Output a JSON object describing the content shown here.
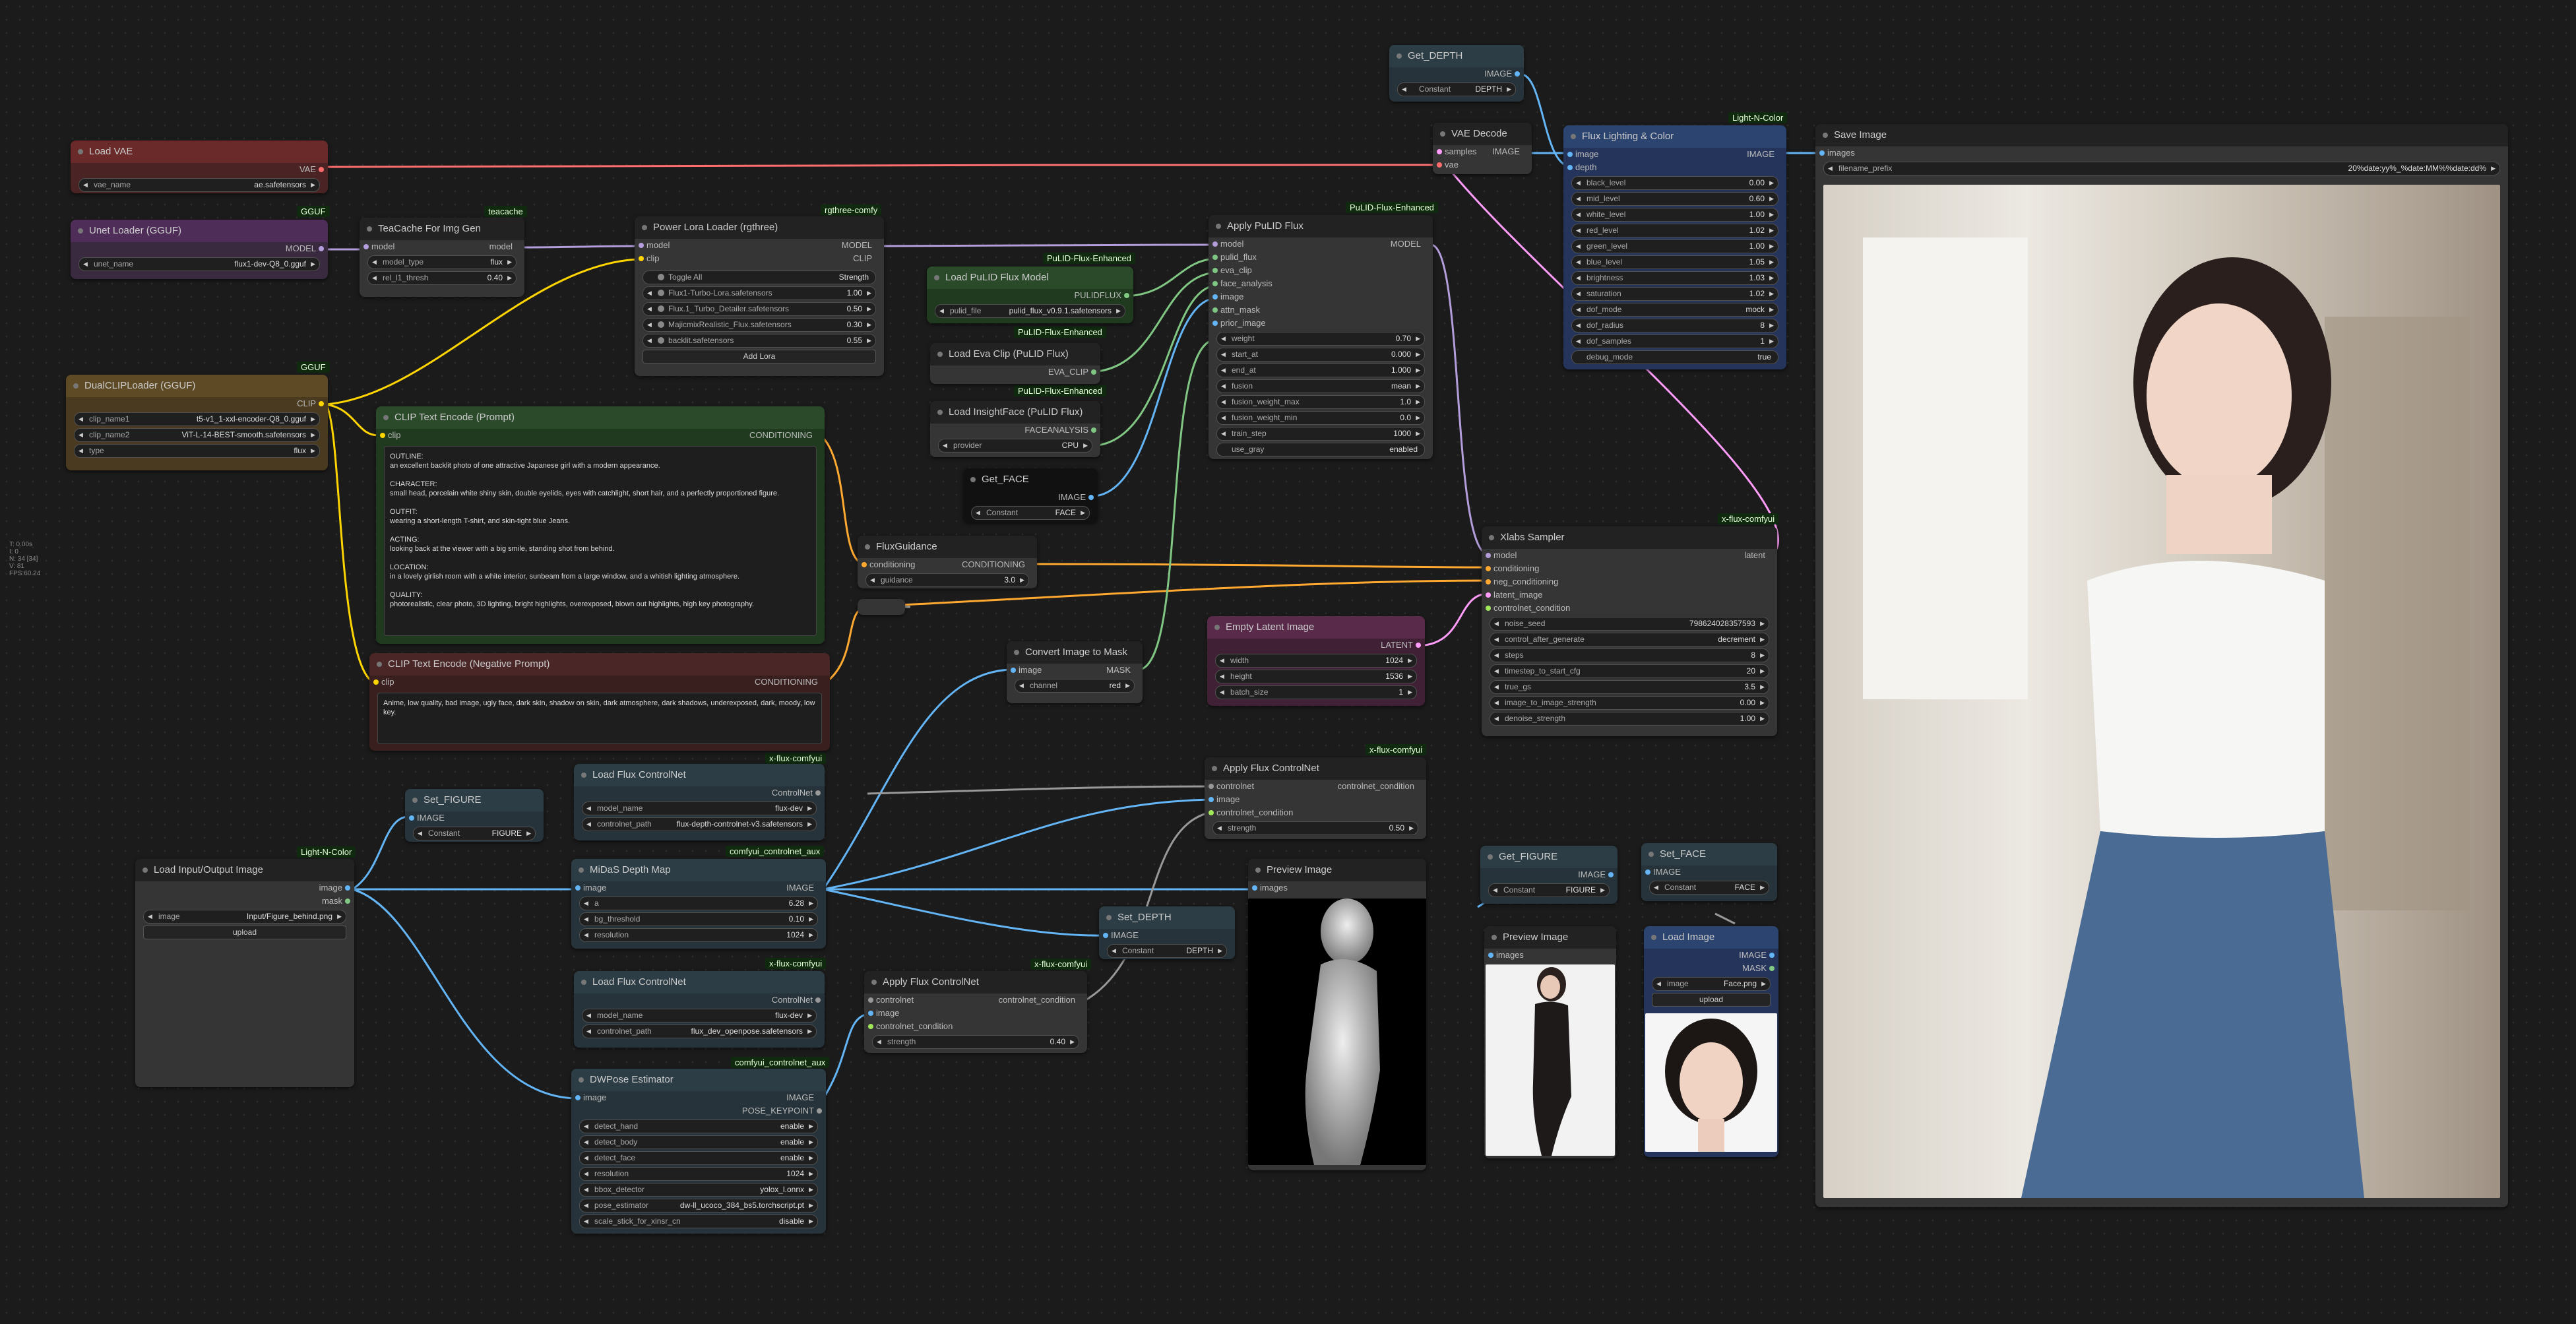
{
  "canvas_stats": [
    "T: 0.00s",
    "I: 0",
    "N: 34 [34]",
    "V: 81",
    "FPS:60.24"
  ],
  "colors": {
    "model": "#b39ddb",
    "clip": "#ffd500",
    "vae": "#ff6e6e",
    "conditioning": "#ffa931",
    "latent": "#ff9cf9",
    "image": "#64b5f6",
    "mask": "#81c784",
    "control": "#a1e85a",
    "generic": "#cccccc"
  },
  "badges": {
    "gguf1": "GGUF",
    "gguf2": "GGUF",
    "teacache": "teacache",
    "rgthree": "rgthree-comfy",
    "pulid1": "PuLID-Flux-Enhanced",
    "pulid2": "PuLID-Flux-Enhanced",
    "pulid3": "PuLID-Flux-Enhanced",
    "pulid4": "PuLID-Flux-Enhanced",
    "lnc1": "Light-N-Color",
    "lnc2": "Light-N-Color",
    "xflux1": "x-flux-comfyui",
    "xflux2": "x-flux-comfyui",
    "xflux3": "x-flux-comfyui",
    "xflux4": "x-flux-comfyui",
    "xflux5": "x-flux-comfyui",
    "aux1": "comfyui_controlnet_aux",
    "aux2": "comfyui_controlnet_aux"
  },
  "load_vae": {
    "title": "Load VAE",
    "out": "VAE",
    "vae_name_label": "vae_name",
    "vae_name": "ae.safetensors"
  },
  "unet_loader": {
    "title": "Unet Loader (GGUF)",
    "out": "MODEL",
    "unet_name_label": "unet_name",
    "unet_name": "flux1-dev-Q8_0.gguf"
  },
  "teacache": {
    "title": "TeaCache For Img Gen",
    "in": "model",
    "out": "model",
    "model_type_label": "model_type",
    "model_type": "flux",
    "rel_l1_label": "rel_l1_thresh",
    "rel_l1": "0.40"
  },
  "dualclip": {
    "title": "DualCLIPLoader (GGUF)",
    "out": "CLIP",
    "clip_name1_label": "clip_name1",
    "clip_name1": "t5-v1_1-xxl-encoder-Q8_0.gguf",
    "clip_name2_label": "clip_name2",
    "clip_name2": "ViT-L-14-BEST-smooth.safetensors",
    "type_label": "type",
    "type": "flux"
  },
  "power_lora": {
    "title": "Power Lora Loader (rgthree)",
    "in_model": "model",
    "in_clip": "clip",
    "out_model": "MODEL",
    "out_clip": "CLIP",
    "toggle_all": "Toggle All",
    "strength_hdr": "Strength",
    "loras": [
      {
        "name": "Flux1-Turbo-Lora.safetensors",
        "strength": "1.00"
      },
      {
        "name": "Flux.1_Turbo_Detailer.safetensors",
        "strength": "0.50"
      },
      {
        "name": "MajicmixRealistic_Flux.safetensors",
        "strength": "0.30"
      },
      {
        "name": "backlit.safetensors",
        "strength": "0.55"
      }
    ],
    "add": "Add Lora"
  },
  "clip_pos": {
    "title": "CLIP Text Encode (Prompt)",
    "in": "clip",
    "out": "CONDITIONING",
    "text": "OUTLINE:\nan excellent backlit photo of one attractive Japanese girl with a modern appearance.\n\nCHARACTER:\nsmall head, porcelain white shiny skin, double eyelids, eyes with catchlight, short hair, and a perfectly proportioned figure.\n\nOUTFIT:\nwearing a short-length T-shirt, and skin-tight blue Jeans.\n\nACTING:\nlooking back at the viewer with a big smile, standing shot from behind.\n\nLOCATION:\nin a lovely girlish room with a white interior, sunbeam from a large window, and a whitish lighting atmosphere.\n\nQUALITY:\nphotorealistic, clear photo, 3D lighting, bright highlights, overexposed, blown out highlights, high key photography."
  },
  "clip_neg": {
    "title": "CLIP Text Encode (Negative Prompt)",
    "in": "clip",
    "out": "CONDITIONING",
    "text": "Anime, low quality, bad image, ugly face, dark skin, shadow on skin, dark atmosphere, dark shadows, underexposed, dark, moody, low key."
  },
  "pulid_model": {
    "title": "Load PuLID Flux Model",
    "out": "PULIDFLUX",
    "label": "pulid_file",
    "value": "pulid_flux_v0.9.1.safetensors"
  },
  "eva_clip": {
    "title": "Load Eva Clip (PuLID Flux)",
    "out": "EVA_CLIP"
  },
  "insightface": {
    "title": "Load InsightFace (PuLID Flux)",
    "out": "FACEANALYSIS",
    "label": "provider",
    "value": "CPU"
  },
  "get_face": {
    "title": "Get_FACE",
    "out": "IMAGE",
    "label": "Constant",
    "value": "FACE"
  },
  "apply_pulid": {
    "title": "Apply PuLID Flux",
    "inputs": [
      "model",
      "pulid_flux",
      "eva_clip",
      "face_analysis",
      "image",
      "attn_mask",
      "prior_image"
    ],
    "out": "MODEL",
    "widgets": [
      {
        "l": "weight",
        "v": "0.70"
      },
      {
        "l": "start_at",
        "v": "0.000"
      },
      {
        "l": "end_at",
        "v": "1.000"
      },
      {
        "l": "fusion",
        "v": "mean"
      },
      {
        "l": "fusion_weight_max",
        "v": "1.0"
      },
      {
        "l": "fusion_weight_min",
        "v": "0.0"
      },
      {
        "l": "train_step",
        "v": "1000"
      }
    ],
    "toggle_label": "use_gray",
    "toggle_value": "enabled"
  },
  "get_depth_top": {
    "title": "Get_DEPTH",
    "out": "IMAGE",
    "label": "Constant",
    "value": "DEPTH"
  },
  "vae_decode": {
    "title": "VAE Decode",
    "in1": "samples",
    "in2": "vae",
    "out": "IMAGE"
  },
  "flux_lighting": {
    "title": "Flux Lighting & Color",
    "in1": "image",
    "in2": "depth",
    "out": "IMAGE",
    "widgets": [
      {
        "l": "black_level",
        "v": "0.00"
      },
      {
        "l": "mid_level",
        "v": "0.60"
      },
      {
        "l": "white_level",
        "v": "1.00"
      },
      {
        "l": "red_level",
        "v": "1.02"
      },
      {
        "l": "green_level",
        "v": "1.00"
      },
      {
        "l": "blue_level",
        "v": "1.05"
      },
      {
        "l": "brightness",
        "v": "1.03"
      },
      {
        "l": "saturation",
        "v": "1.02"
      },
      {
        "l": "dof_mode",
        "v": "mock"
      },
      {
        "l": "dof_radius",
        "v": "8"
      },
      {
        "l": "dof_samples",
        "v": "1"
      }
    ],
    "toggle_label": "debug_mode",
    "toggle_value": "true"
  },
  "save_image": {
    "title": "Save Image",
    "in": "images",
    "prefix_label": "filename_prefix",
    "prefix": "20%date:yy%_%date:MM%%date:dd%"
  },
  "flux_guidance": {
    "title": "FluxGuidance",
    "in": "conditioning",
    "out": "CONDITIONING",
    "label": "guidance",
    "value": "3.0"
  },
  "xlabs_sampler": {
    "title": "Xlabs Sampler",
    "inputs": [
      "model",
      "conditioning",
      "neg_conditioning",
      "latent_image",
      "controlnet_condition"
    ],
    "out": "latent",
    "widgets": [
      {
        "l": "noise_seed",
        "v": "798624028357593"
      },
      {
        "l": "control_after_generate",
        "v": "decrement"
      },
      {
        "l": "steps",
        "v": "8"
      },
      {
        "l": "timestep_to_start_cfg",
        "v": "20"
      },
      {
        "l": "true_gs",
        "v": "3.5"
      },
      {
        "l": "image_to_image_strength",
        "v": "0.00"
      },
      {
        "l": "denoise_strength",
        "v": "1.00"
      }
    ]
  },
  "empty_latent": {
    "title": "Empty Latent Image",
    "out": "LATENT",
    "widgets": [
      {
        "l": "width",
        "v": "1024"
      },
      {
        "l": "height",
        "v": "1536"
      },
      {
        "l": "batch_size",
        "v": "1"
      }
    ]
  },
  "convert_mask": {
    "title": "Convert Image to Mask",
    "in": "image",
    "out": "MASK",
    "label": "channel",
    "value": "red"
  },
  "load_cn1": {
    "title": "Load Flux ControlNet",
    "out": "ControlNet",
    "w1l": "model_name",
    "w1v": "flux-dev",
    "w2l": "controlnet_path",
    "w2v": "flux-depth-controlnet-v3.safetensors"
  },
  "apply_cn1": {
    "title": "Apply Flux ControlNet",
    "in1": "controlnet",
    "in2": "image",
    "in3": "controlnet_condition",
    "out": "controlnet_condition",
    "label": "strength",
    "value": "0.50"
  },
  "set_figure": {
    "title": "Set_FIGURE",
    "in": "IMAGE",
    "label": "Constant",
    "value": "FIGURE"
  },
  "load_io": {
    "title": "Load Input/Output Image",
    "out1": "image",
    "out2": "mask",
    "label": "image",
    "value": "Input/Figure_behind.png",
    "upload": "upload"
  },
  "midas": {
    "title": "MiDaS Depth Map",
    "in": "image",
    "out": "IMAGE",
    "widgets": [
      {
        "l": "a",
        "v": "6.28"
      },
      {
        "l": "bg_threshold",
        "v": "0.10"
      },
      {
        "l": "resolution",
        "v": "1024"
      }
    ]
  },
  "preview1": {
    "title": "Preview Image",
    "in": "images"
  },
  "set_depth": {
    "title": "Set_DEPTH",
    "in": "IMAGE",
    "label": "Constant",
    "value": "DEPTH"
  },
  "load_cn2": {
    "title": "Load Flux ControlNet",
    "out": "ControlNet",
    "w1l": "model_name",
    "w1v": "flux-dev",
    "w2l": "controlnet_path",
    "w2v": "flux_dev_openpose.safetensors"
  },
  "apply_cn2": {
    "title": "Apply Flux ControlNet",
    "in1": "controlnet",
    "in2": "image",
    "in3": "controlnet_condition",
    "out": "controlnet_condition",
    "label": "strength",
    "value": "0.40"
  },
  "dwpose": {
    "title": "DWPose Estimator",
    "in": "image",
    "out1": "IMAGE",
    "out2": "POSE_KEYPOINT",
    "widgets": [
      {
        "l": "detect_hand",
        "v": "enable"
      },
      {
        "l": "detect_body",
        "v": "enable"
      },
      {
        "l": "detect_face",
        "v": "enable"
      },
      {
        "l": "resolution",
        "v": "1024"
      },
      {
        "l": "bbox_detector",
        "v": "yolox_l.onnx"
      },
      {
        "l": "pose_estimator",
        "v": "dw-ll_ucoco_384_bs5.torchscript.pt"
      },
      {
        "l": "scale_stick_for_xinsr_cn",
        "v": "disable"
      }
    ]
  },
  "get_figure": {
    "title": "Get_FIGURE",
    "out": "IMAGE",
    "label": "Constant",
    "value": "FIGURE"
  },
  "set_face": {
    "title": "Set_FACE",
    "in": "IMAGE",
    "label": "Constant",
    "value": "FACE"
  },
  "preview2": {
    "title": "Preview Image",
    "in": "images"
  },
  "load_image": {
    "title": "Load Image",
    "out1": "IMAGE",
    "out2": "MASK",
    "label": "image",
    "value": "Face.png",
    "upload": "upload"
  }
}
